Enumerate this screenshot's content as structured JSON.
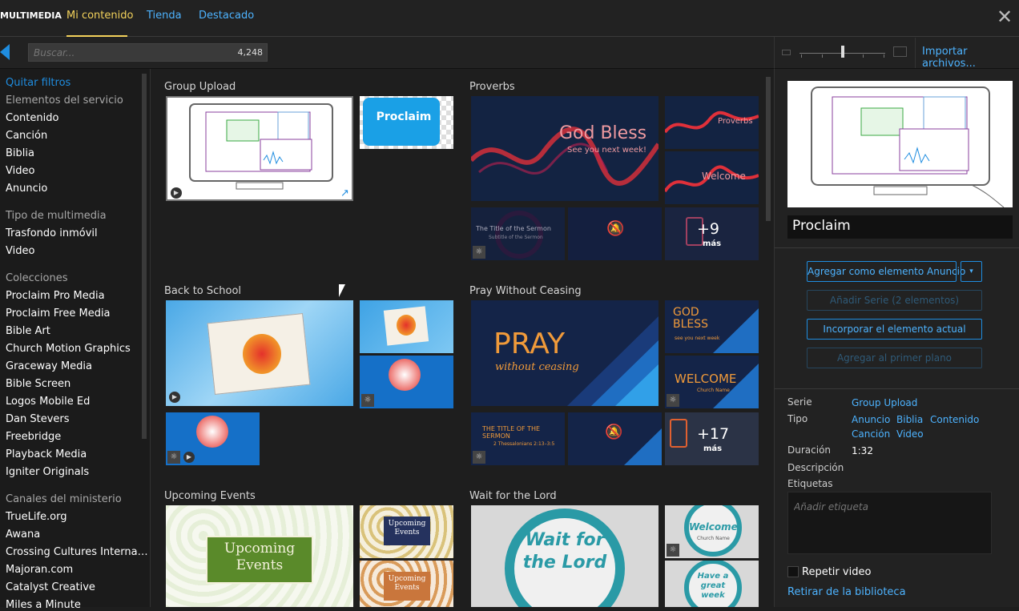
{
  "topbar": {
    "brand": "MULTIMEDIA",
    "tabs": [
      {
        "label": "Mi contenido"
      },
      {
        "label": "Tienda"
      },
      {
        "label": "Destacado"
      }
    ]
  },
  "toolbar": {
    "search_placeholder": "Buscar...",
    "count": "4,248",
    "import_label": "Importar archivos..."
  },
  "sidebar": {
    "clear_filters": "Quitar filtros",
    "service_heading": "Elementos del servicio",
    "service_items": [
      "Contenido",
      "Canción",
      "Biblia",
      "Video",
      "Anuncio"
    ],
    "media_heading": "Tipo de multimedia",
    "media_items": [
      "Trasfondo inmóvil",
      "Video"
    ],
    "collections_heading": "Colecciones",
    "collections": [
      "Proclaim Pro Media",
      "Proclaim Free Media",
      "Bible Art",
      "Church Motion Graphics",
      "Graceway Media",
      "Bible Screen",
      "Logos Mobile Ed",
      "Dan Stevers",
      "Freebridge",
      "Playback Media",
      "Igniter Originals"
    ],
    "ministry_heading": "Canales del ministerio",
    "ministry": [
      "TrueLife.org",
      "Awana",
      "Crossing Cultures Interna…",
      "Majoran.com",
      "Catalyst Creative",
      "Miles a Minute"
    ]
  },
  "content": {
    "groups": [
      {
        "title": "Group Upload",
        "tile_label": "Proclaim"
      },
      {
        "title": "Proverbs",
        "hero_text": "God Bless",
        "hero_sub": "See you next week!",
        "t1": "Proverbs",
        "t2": "Welcome",
        "t3": "The Title of the Sermon",
        "t3_sub": "Subtitle of the Sermon",
        "more": "+9",
        "more_sub": "más"
      },
      {
        "title": "Back to School"
      },
      {
        "title": "Pray Without Ceasing",
        "hero_text": "PRAY",
        "hero_sub": "without ceasing",
        "t1": "GOD BLESS",
        "t1_sub": "see you next week",
        "t2": "WELCOME",
        "t2_sub": "Church Name",
        "t3": "THE TITLE OF THE SERMON",
        "t3_sub": "2 Thessalonians 2:13–3:5",
        "more": "+17",
        "more_sub": "más"
      },
      {
        "title": "Upcoming Events",
        "hero_text": "Upcoming Events",
        "t1": "Upcoming Events",
        "t2": "Upcoming Events"
      },
      {
        "title": "Wait for the Lord",
        "hero_text": "Wait for the Lord",
        "t1": "Welcome",
        "t1_sub": "Church Name",
        "t2": "Have a great week"
      }
    ]
  },
  "panel": {
    "title": "Proclaim",
    "buttons": {
      "add_announcement": "Agregar como elemento Anuncio",
      "add_series": "Añadir Serie (2 elementos)",
      "incorporate": "Incorporar el elemento actual",
      "add_foreground": "Agregar al primer plano"
    },
    "labels": {
      "series": "Serie",
      "type": "Tipo",
      "duration": "Duración",
      "description": "Descripción",
      "tags": "Etiquetas"
    },
    "values": {
      "series": "Group Upload",
      "types": [
        "Anuncio",
        "Biblia",
        "Contenido",
        "Canción",
        "Video"
      ],
      "duration": "1:32"
    },
    "tags_placeholder": "Añadir etiqueta",
    "repeat_label": "Repetir video",
    "remove_label": "Retirar de la biblioteca"
  },
  "colors": {
    "accent": "#1f8de0",
    "active_tab": "#f3d25b",
    "background": "#1e1e1e"
  }
}
